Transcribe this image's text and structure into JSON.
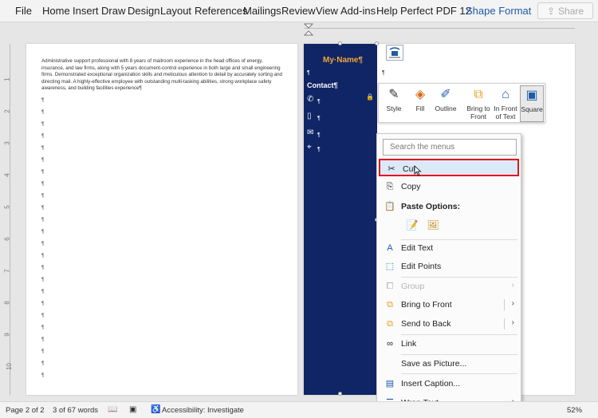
{
  "ribbon": {
    "tabs": [
      "File",
      "Home",
      "Insert",
      "Draw",
      "Design",
      "Layout",
      "References",
      "Mailings",
      "Review",
      "View",
      "Add-ins",
      "Help",
      "Perfect PDF 12",
      "Shape Format"
    ],
    "active_tab": "Shape Format",
    "share_label": "Share"
  },
  "page1": {
    "paragraph": "Administrative support professional with 8 years of mailroom experience in the head offices of energy, insurance, and law firms, along with 5 years document-control experience in both large and small engineering firms. Demonstrated exceptional organization skills and meticulous attention to detail by accurately sorting and directing mail. A highly-effective employee with outstanding multi-tasking abilities, strong workplace safety awareness, and building facilities experience¶",
    "pilcrow": "¶"
  },
  "page2": {
    "name": "My·Name¶",
    "contact": "Contact¶",
    "pilcrow": "¶"
  },
  "mini_toolbar": {
    "style": "Style",
    "fill": "Fill",
    "outline": "Outline",
    "bring_to_front": "Bring to Front",
    "in_front_of_text": "In Front of Text",
    "square": "Square"
  },
  "context_menu": {
    "search_placeholder": "Search the menus",
    "cut": "Cut",
    "copy": "Copy",
    "paste_options": "Paste Options:",
    "edit_text": "Edit Text",
    "edit_points": "Edit Points",
    "group": "Group",
    "bring_to_front": "Bring to Front",
    "send_to_back": "Send to Back",
    "link": "Link",
    "save_as_picture": "Save as Picture...",
    "insert_caption": "Insert Caption...",
    "wrap_text": "Wrap Text"
  },
  "statusbar": {
    "page": "Page 2 of 2",
    "words": "3 of 67 words",
    "accessibility": "Accessibility: Investigate",
    "zoom": "52%"
  },
  "colors": {
    "sidebar": "#102565",
    "name_accent": "#f0a637",
    "highlight_border": "#e1141e",
    "active_tab": "#1e5aa8"
  }
}
